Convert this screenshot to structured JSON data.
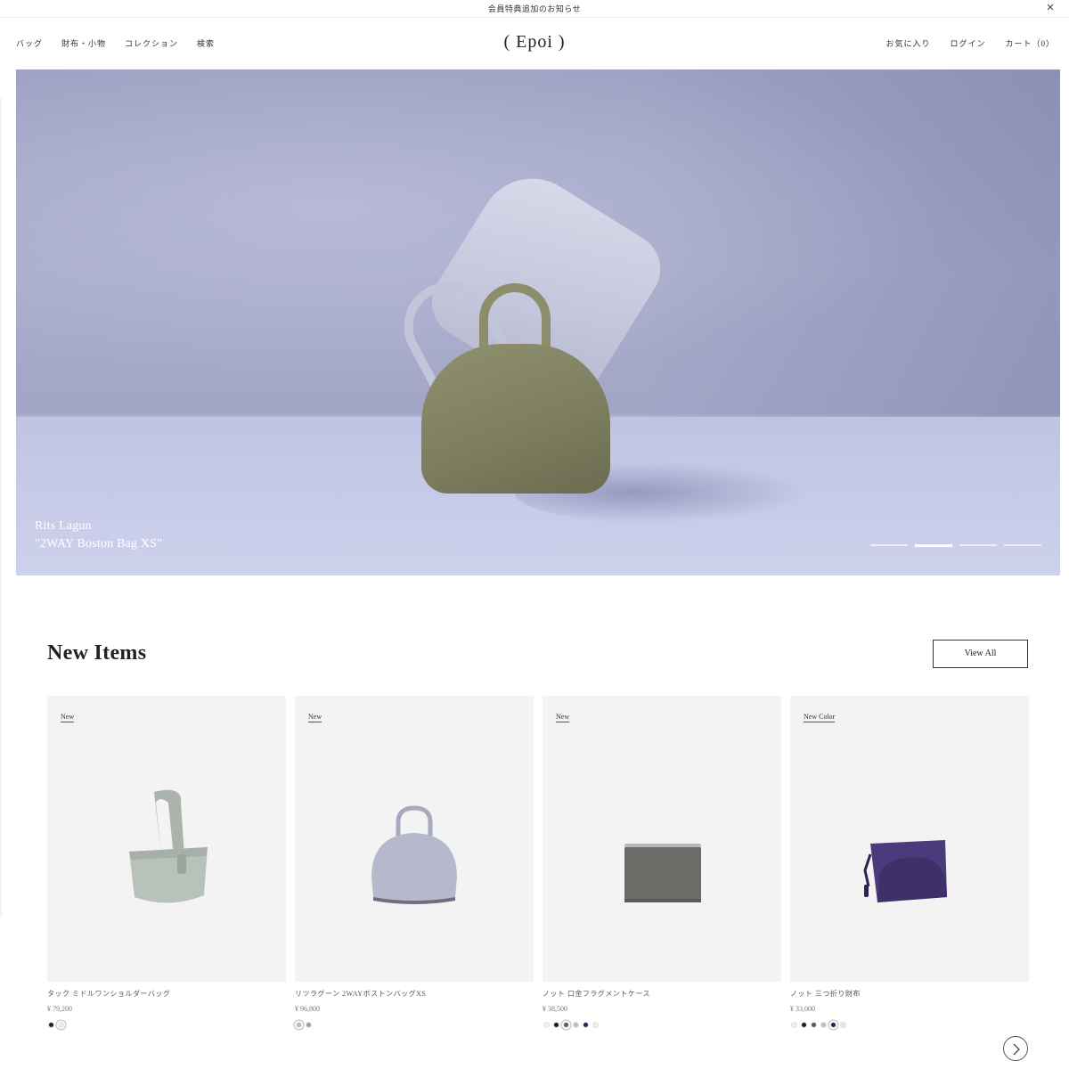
{
  "announcement": {
    "text": "会員特典追加のお知らせ",
    "close_icon": "close-icon"
  },
  "header": {
    "logo": "( Epoi )",
    "nav_left": [
      {
        "label": "バッグ"
      },
      {
        "label": "財布・小物"
      },
      {
        "label": "コレクション"
      },
      {
        "label": "検索"
      }
    ],
    "nav_right": [
      {
        "label": "お気に入り"
      },
      {
        "label": "ログイン"
      },
      {
        "label": "カート（0）"
      }
    ]
  },
  "hero": {
    "caption_line1": "Rits Lagun",
    "caption_line2": "\"2WAY Boston Bag XS\"",
    "slide_count": 4,
    "active_slide": 2
  },
  "new_items": {
    "title": "New Items",
    "view_all_label": "View All",
    "next_icon": "chevron-right-icon",
    "products": [
      {
        "badge": "New",
        "name": "タック ミドルワンショルダーバッグ",
        "price": "¥ 79,200",
        "swatches": [
          "#1e1e1e",
          "#e9ecea"
        ],
        "selected_swatch": 1,
        "product_color": "#b9c1bb"
      },
      {
        "badge": "New",
        "name": "リツラグーン 2WAYボストンバッグXS",
        "price": "¥ 96,800",
        "swatches": [
          "#b7bad4",
          "#9fa28a"
        ],
        "selected_swatch": 0,
        "product_color": "#b6b9cc"
      },
      {
        "badge": "New",
        "name": "ノット 口金フラグメントケース",
        "price": "¥ 38,500",
        "swatches": [
          "#efefef",
          "#1f1f1f",
          "#5b5b58",
          "#bcbdab",
          "#2e1f52",
          "#e9ecea"
        ],
        "selected_swatch": 2,
        "product_color": "#6b6b68"
      },
      {
        "badge": "New Color",
        "name": "ノット 三つ折り財布",
        "price": "¥ 33,000",
        "swatches": [
          "#efefef",
          "#1f1f1f",
          "#5b5b58",
          "#bcbdab",
          "#2e1f52",
          "#dde7f0"
        ],
        "selected_swatch": 4,
        "product_color": "#4b3a7c"
      }
    ]
  }
}
